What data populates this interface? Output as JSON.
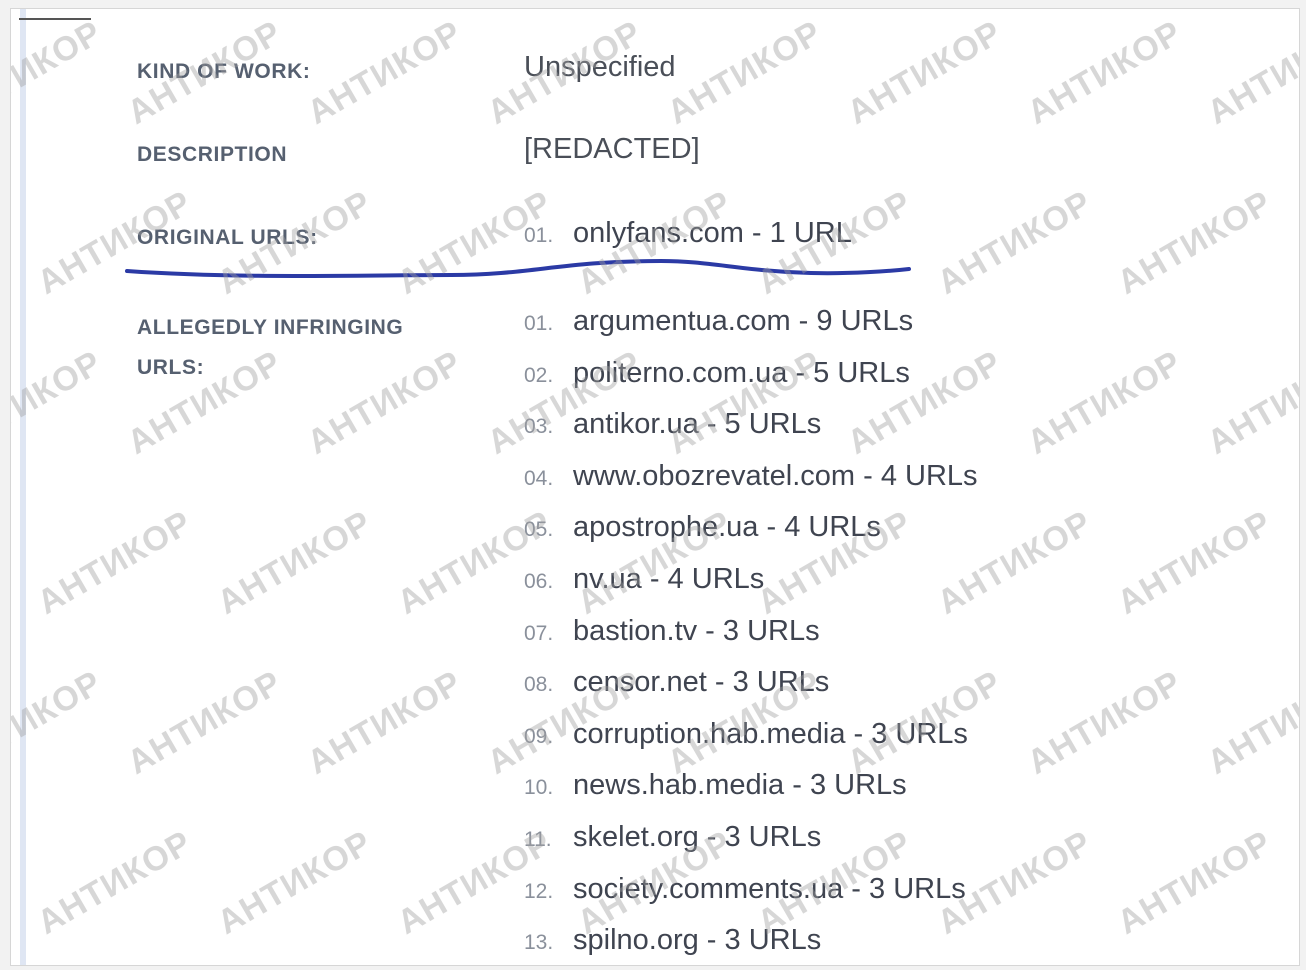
{
  "fields": {
    "kind_label": "KIND OF WORK:",
    "kind_value": "Unspecified",
    "description_label": "DESCRIPTION",
    "description_value": "[REDACTED]",
    "original_label": "ORIGINAL URLS:",
    "infringing_label_line1": "ALLEGEDLY INFRINGING",
    "infringing_label_line2": "URLS:"
  },
  "original_urls": [
    {
      "num": "01.",
      "text": "onlyfans.com - 1 URL"
    }
  ],
  "infringing_urls": [
    {
      "num": "01.",
      "text": "argumentua.com - 9 URLs"
    },
    {
      "num": "02.",
      "text": "politerno.com.ua - 5 URLs"
    },
    {
      "num": "03.",
      "text": "antikor.ua - 5 URLs"
    },
    {
      "num": "04.",
      "text": "www.obozrevatel.com - 4 URLs"
    },
    {
      "num": "05.",
      "text": "apostrophe.ua - 4 URLs"
    },
    {
      "num": "06.",
      "text": "nv.ua - 4 URLs"
    },
    {
      "num": "07.",
      "text": "bastion.tv - 3 URLs"
    },
    {
      "num": "08.",
      "text": "censor.net - 3 URLs"
    },
    {
      "num": "09.",
      "text": "corruption.hab.media - 3 URLs"
    },
    {
      "num": "10.",
      "text": "news.hab.media - 3 URLs"
    },
    {
      "num": "11.",
      "text": "skelet.org - 3 URLs"
    },
    {
      "num": "12.",
      "text": "society.comments.ua - 3 URLs"
    },
    {
      "num": "13.",
      "text": "spilno.org - 3 URLs"
    }
  ],
  "watermark": {
    "text": "АНТИКОР"
  },
  "colors": {
    "underline": "#2b3aa5"
  }
}
